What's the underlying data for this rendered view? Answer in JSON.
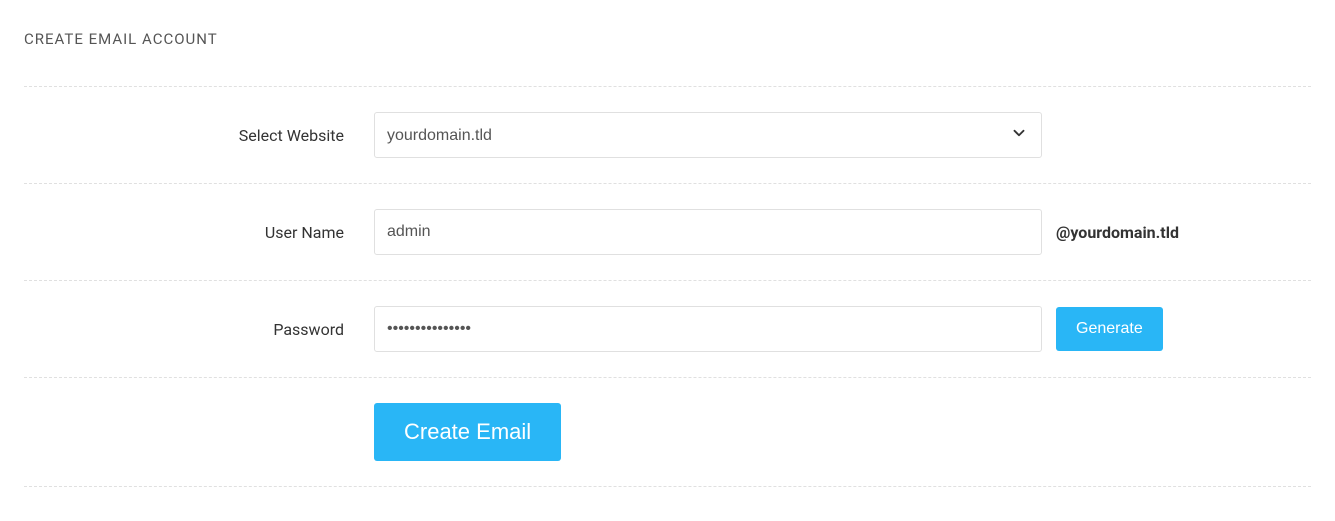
{
  "panel_title": "CREATE EMAIL ACCOUNT",
  "labels": {
    "select_website": "Select Website",
    "user_name": "User Name",
    "password": "Password"
  },
  "values": {
    "website": "yourdomain.tld",
    "username": "admin",
    "password": "•••••••••••••••"
  },
  "domain_suffix": "@yourdomain.tld",
  "buttons": {
    "generate": "Generate",
    "create": "Create Email"
  }
}
